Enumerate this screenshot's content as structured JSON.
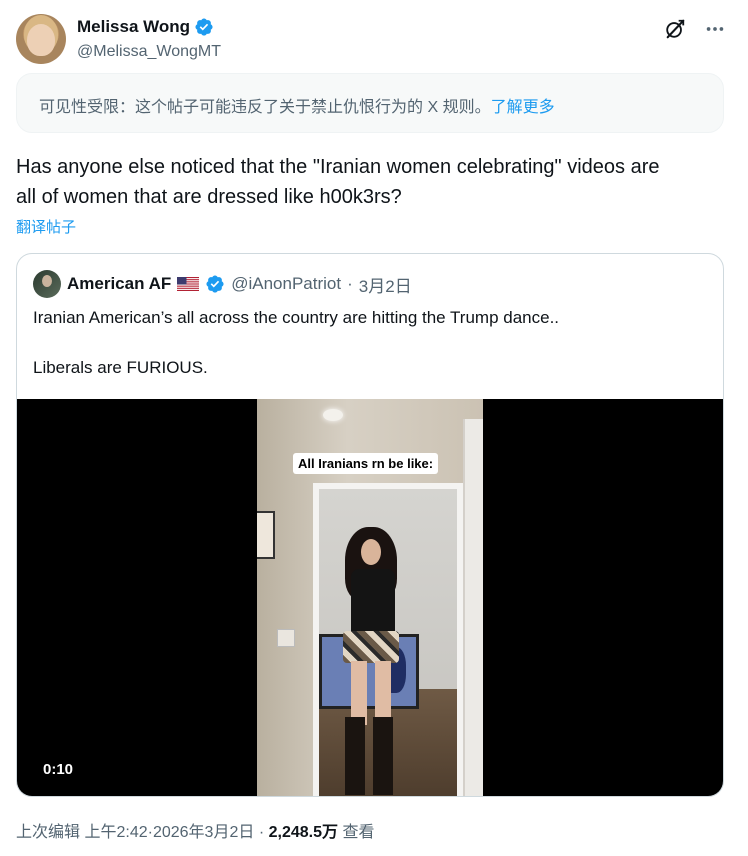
{
  "post": {
    "author": {
      "display_name": "Melissa Wong",
      "handle": "@Melissa_WongMT",
      "verified": true
    },
    "header_icons": [
      "grok-icon",
      "more-icon"
    ],
    "notice": {
      "text": "可见性受限：这个帖子可能违反了关于禁止仇恨行为的 X 规则。",
      "link": "了解更多"
    },
    "text_line1": "Has anyone else noticed that the \"Iranian women celebrating\" videos are",
    "text_line2": "all of women that are dressed like h00k3rs?",
    "translate_label": "翻译帖子"
  },
  "quote": {
    "display_name": "American AF",
    "flag": "us-flag",
    "handle": "@iAnonPatriot",
    "dot": "·",
    "date": "3月2日",
    "text_1": "Iranian American’s all across the country are hitting the Trump dance..",
    "text_2": "Liberals are FURIOUS.",
    "video": {
      "caption": "All Iranians rn be like:",
      "duration": "0:10"
    }
  },
  "meta": {
    "edited": "上次编辑",
    "time": "上午2:42",
    "sep1": "·",
    "date": "2026年3月2日",
    "sep2": "·",
    "views_count": "2,248.5万",
    "views_label": "查看"
  },
  "colors": {
    "accent": "#1d9bf0",
    "text_secondary": "#536471",
    "border": "#cfd9de"
  }
}
